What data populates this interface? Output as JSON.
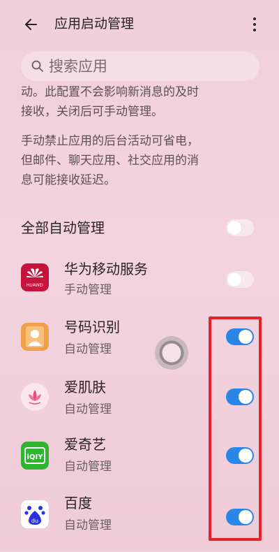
{
  "header": {
    "title": "应用启动管理"
  },
  "search": {
    "placeholder": "搜索应用"
  },
  "description": [
    "动。此配置不会影响新消息的及时",
    "接收，关闭后可手动管理。",
    "手动禁止应用的后台活动可省电，",
    "但邮件、聊天应用、社交应用的消",
    "息可能接收延迟。"
  ],
  "all_auto": {
    "label": "全部自动管理",
    "enabled": false
  },
  "apps": [
    {
      "name": "华为移动服务",
      "status": "手动管理",
      "icon": "huawei-icon",
      "icon_text": "HUAWEI",
      "enabled": false
    },
    {
      "name": "号码识别",
      "status": "自动管理",
      "icon": "contact-id-icon",
      "enabled": true
    },
    {
      "name": "爱肌肤",
      "status": "自动管理",
      "icon": "skincare-lotus-icon",
      "enabled": true
    },
    {
      "name": "爱奇艺",
      "status": "自动管理",
      "icon": "iqiyi-icon",
      "icon_text": "iQIY",
      "enabled": true
    },
    {
      "name": "百度",
      "status": "自动管理",
      "icon": "baidu-paw-icon",
      "icon_text": "du",
      "enabled": true
    }
  ],
  "colors": {
    "accent": "#2a86e6",
    "highlight": "#e8222a",
    "huawei": "#c4143c",
    "iqiyi": "#2fb52f",
    "contact": "#f0a04b",
    "baidu": "#2932e1"
  }
}
